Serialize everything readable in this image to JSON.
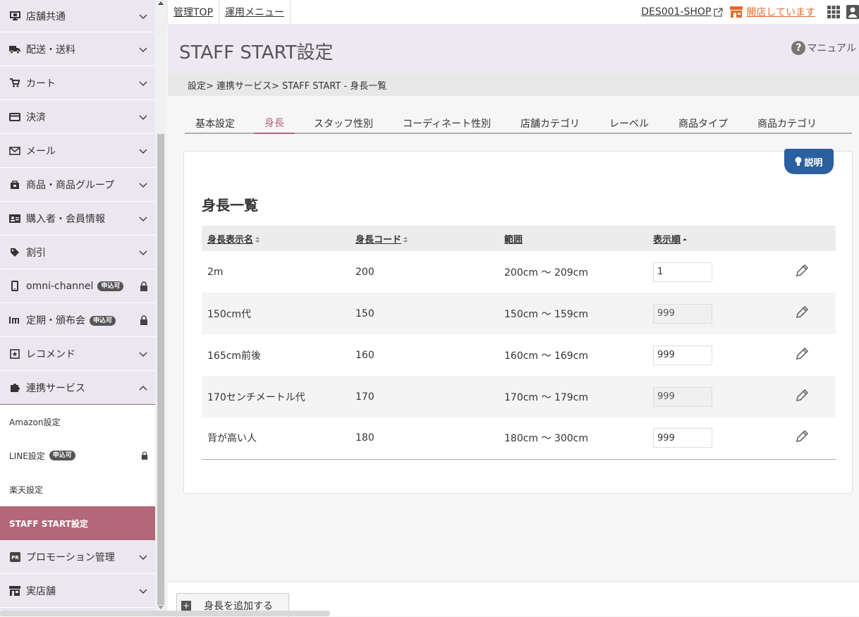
{
  "sidebar": {
    "items": [
      {
        "label": "店舗共通",
        "icon": "monitor-icon"
      },
      {
        "label": "配送・送料",
        "icon": "truck-icon"
      },
      {
        "label": "カート",
        "icon": "cart-icon"
      },
      {
        "label": "決済",
        "icon": "credit-card-icon"
      },
      {
        "label": "メール",
        "icon": "mail-icon"
      },
      {
        "label": "商品・商品グループ",
        "icon": "product-icon"
      },
      {
        "label": "購入者・会員情報",
        "icon": "id-card-icon"
      },
      {
        "label": "割引",
        "icon": "tag-icon"
      },
      {
        "label": "omni-channel",
        "icon": "mobile-icon",
        "badge": "申込可"
      },
      {
        "label": "定期・頒布会",
        "icon": "calendar-icon",
        "badge": "申込可"
      },
      {
        "label": "レコメンド",
        "icon": "star-box-icon"
      },
      {
        "label": "連携サービス",
        "icon": "puzzle-icon"
      }
    ],
    "sub_items": [
      {
        "label": "Amazon設定"
      },
      {
        "label": "LINE設定",
        "badge": "申込可"
      },
      {
        "label": "楽天設定"
      },
      {
        "label": "STAFF START設定"
      }
    ],
    "items_after": [
      {
        "label": "プロモーション管理",
        "icon": "pr-icon"
      },
      {
        "label": "実店舗",
        "icon": "store-icon"
      }
    ]
  },
  "topbar": {
    "admin_top": "管理TOP",
    "ops_menu": "運用メニュー",
    "shop_name": "DES001-SHOP",
    "open_status": "開店しています"
  },
  "header": {
    "title": "STAFF START設定",
    "manual": "マニュアル"
  },
  "breadcrumb": "設定> 連携サービス> STAFF START - 身長一覧",
  "tabs": [
    "基本設定",
    "身長",
    "スタッフ性別",
    "コーディネート性別",
    "店舗カテゴリ",
    "レーベル",
    "商品タイプ",
    "商品カテゴリ"
  ],
  "active_tab": "身長",
  "help_badge": "説明",
  "section_title": "身長一覧",
  "table": {
    "headers": [
      "身長表示名",
      "身長コード",
      "範囲",
      "表示順"
    ],
    "rows": [
      {
        "name": "2m",
        "code": "200",
        "range": "200cm 〜 209cm",
        "order": "1"
      },
      {
        "name": "150cm代",
        "code": "150",
        "range": "150cm 〜 159cm",
        "order": "999"
      },
      {
        "name": "165cm前後",
        "code": "160",
        "range": "160cm 〜 169cm",
        "order": "999"
      },
      {
        "name": "170センチメートル代",
        "code": "170",
        "range": "170cm 〜 179cm",
        "order": "999"
      },
      {
        "name": "背が高い人",
        "code": "180",
        "range": "180cm 〜 300cm",
        "order": "999"
      }
    ]
  },
  "add_button": "身長を追加する",
  "colors": {
    "accent": "#b26879",
    "open_status": "#e36b2c",
    "help_badge": "#2a5fa0"
  }
}
